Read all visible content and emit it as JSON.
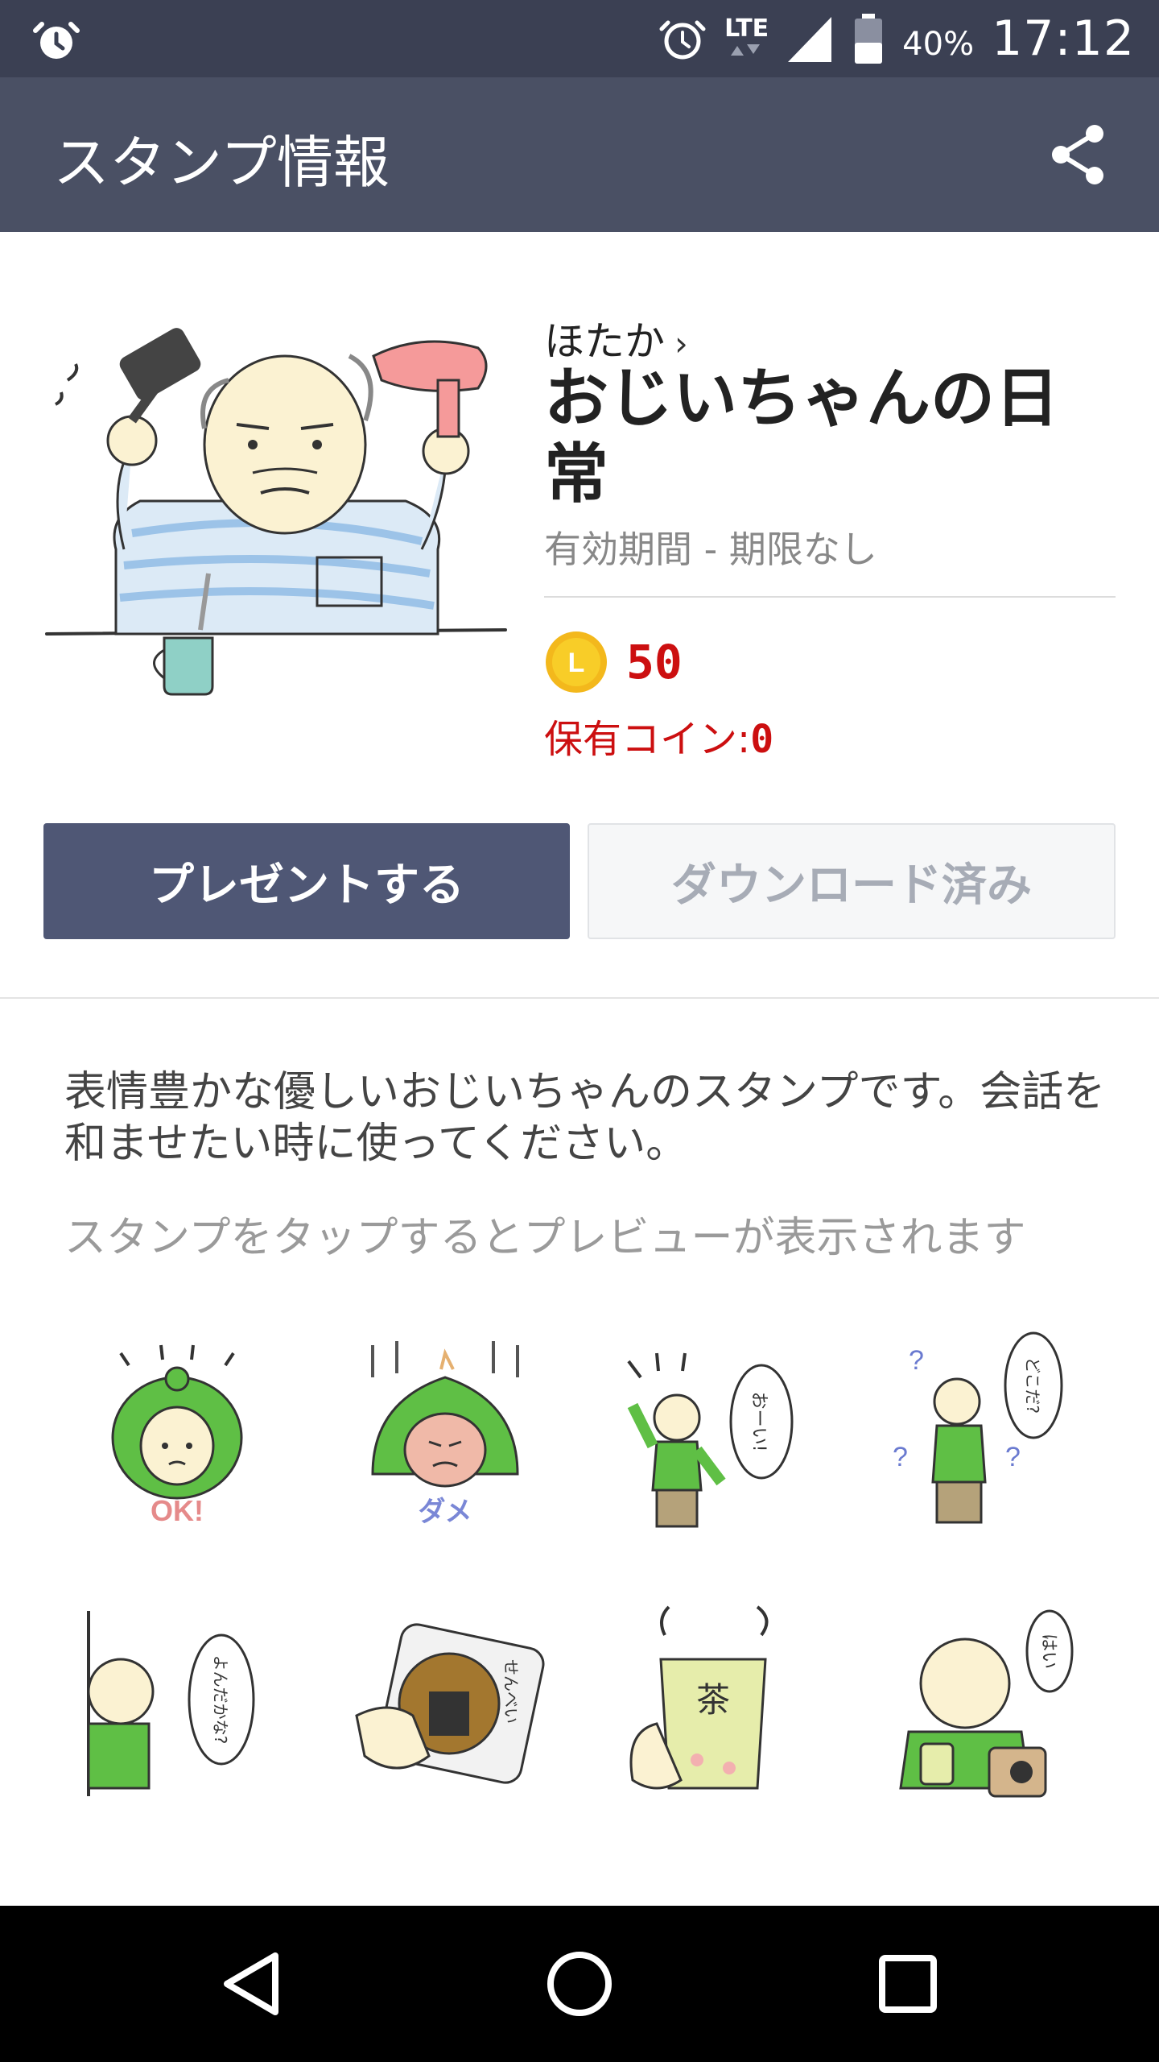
{
  "status_bar": {
    "network": "LTE",
    "battery": "40%",
    "time": "17:12"
  },
  "app_bar": {
    "title": "スタンプ情報",
    "share_icon": "share-icon"
  },
  "product": {
    "author": "ほたか",
    "author_chevron": "›",
    "title": "おじいちゃんの日常",
    "validity": "有効期間 - 期限なし",
    "coin_letter": "L",
    "price": "50",
    "owned_label": "保有コイン:",
    "owned_count": "0"
  },
  "buttons": {
    "present": "プレゼントする",
    "download": "ダウンロード済み"
  },
  "description": "表情豊かな優しいおじいちゃんのスタンプです。会話を和ませたい時に使ってください。",
  "hint": "スタンプをタップするとプレビューが表示されます",
  "stickers": [
    {
      "name": "sticker-ok",
      "caption": "OK!"
    },
    {
      "name": "sticker-dame",
      "caption": "ダメ"
    },
    {
      "name": "sticker-oi",
      "caption": "おーい!"
    },
    {
      "name": "sticker-dokoda",
      "caption": "どこだ?"
    },
    {
      "name": "sticker-yonda",
      "caption": "よんだかな?"
    },
    {
      "name": "sticker-senbei",
      "caption": "せんべい"
    },
    {
      "name": "sticker-cha",
      "caption": "茶"
    },
    {
      "name": "sticker-hai",
      "caption": "はい"
    }
  ],
  "colors": {
    "status_bar": "#3b4053",
    "app_bar": "#4a5064",
    "present_button": "#4f5775",
    "price_red": "#cc0f10",
    "sticker_green": "#5fbf45"
  },
  "nav": {
    "back_icon": "back-triangle-icon",
    "home_icon": "home-circle-icon",
    "recents_icon": "recents-square-icon"
  }
}
